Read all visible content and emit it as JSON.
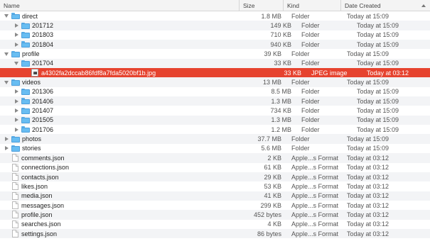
{
  "columns": {
    "name": "Name",
    "size": "Size",
    "kind": "Kind",
    "date": "Date Created"
  },
  "rows": [
    {
      "depth": 0,
      "expand": "down",
      "icon": "folder",
      "name": "direct",
      "size": "1.8 MB",
      "kind": "Folder",
      "date": "Today at 15:09"
    },
    {
      "depth": 1,
      "expand": "right",
      "icon": "folder",
      "name": "201712",
      "size": "149 KB",
      "kind": "Folder",
      "date": "Today at 15:09"
    },
    {
      "depth": 1,
      "expand": "right",
      "icon": "folder",
      "name": "201803",
      "size": "710 KB",
      "kind": "Folder",
      "date": "Today at 15:09"
    },
    {
      "depth": 1,
      "expand": "right",
      "icon": "folder",
      "name": "201804",
      "size": "940 KB",
      "kind": "Folder",
      "date": "Today at 15:09"
    },
    {
      "depth": 0,
      "expand": "down",
      "icon": "folder",
      "name": "profile",
      "size": "39 KB",
      "kind": "Folder",
      "date": "Today at 15:09"
    },
    {
      "depth": 1,
      "expand": "down",
      "icon": "folder",
      "name": "201704",
      "size": "33 KB",
      "kind": "Folder",
      "date": "Today at 15:09"
    },
    {
      "depth": 2,
      "expand": "none",
      "icon": "image",
      "name": "a4302fa2dccab86fdf8a7fda5020bf1b.jpg",
      "size": "33 KB",
      "kind": "JPEG image",
      "date": "Today at 03:12",
      "selected": true
    },
    {
      "depth": 0,
      "expand": "down",
      "icon": "folder",
      "name": "videos",
      "size": "13 MB",
      "kind": "Folder",
      "date": "Today at 15:09"
    },
    {
      "depth": 1,
      "expand": "right",
      "icon": "folder",
      "name": "201306",
      "size": "8.5 MB",
      "kind": "Folder",
      "date": "Today at 15:09"
    },
    {
      "depth": 1,
      "expand": "right",
      "icon": "folder",
      "name": "201406",
      "size": "1.3 MB",
      "kind": "Folder",
      "date": "Today at 15:09"
    },
    {
      "depth": 1,
      "expand": "right",
      "icon": "folder",
      "name": "201407",
      "size": "734 KB",
      "kind": "Folder",
      "date": "Today at 15:09"
    },
    {
      "depth": 1,
      "expand": "right",
      "icon": "folder",
      "name": "201505",
      "size": "1.3 MB",
      "kind": "Folder",
      "date": "Today at 15:09"
    },
    {
      "depth": 1,
      "expand": "right",
      "icon": "folder",
      "name": "201706",
      "size": "1.2 MB",
      "kind": "Folder",
      "date": "Today at 15:09"
    },
    {
      "depth": 0,
      "expand": "right",
      "icon": "folder",
      "name": "photos",
      "size": "37.7 MB",
      "kind": "Folder",
      "date": "Today at 15:09"
    },
    {
      "depth": 0,
      "expand": "right",
      "icon": "folder",
      "name": "stories",
      "size": "5.6 MB",
      "kind": "Folder",
      "date": "Today at 15:09"
    },
    {
      "depth": 0,
      "expand": "none",
      "icon": "document",
      "name": "comments.json",
      "size": "2 KB",
      "kind": "Apple...s Format",
      "date": "Today at 03:12"
    },
    {
      "depth": 0,
      "expand": "none",
      "icon": "document",
      "name": "connections.json",
      "size": "61 KB",
      "kind": "Apple...s Format",
      "date": "Today at 03:12"
    },
    {
      "depth": 0,
      "expand": "none",
      "icon": "document",
      "name": "contacts.json",
      "size": "29 KB",
      "kind": "Apple...s Format",
      "date": "Today at 03:12"
    },
    {
      "depth": 0,
      "expand": "none",
      "icon": "document",
      "name": "likes.json",
      "size": "53 KB",
      "kind": "Apple...s Format",
      "date": "Today at 03:12"
    },
    {
      "depth": 0,
      "expand": "none",
      "icon": "document",
      "name": "media.json",
      "size": "41 KB",
      "kind": "Apple...s Format",
      "date": "Today at 03:12"
    },
    {
      "depth": 0,
      "expand": "none",
      "icon": "document",
      "name": "messages.json",
      "size": "299 KB",
      "kind": "Apple...s Format",
      "date": "Today at 03:12"
    },
    {
      "depth": 0,
      "expand": "none",
      "icon": "document",
      "name": "profile.json",
      "size": "452 bytes",
      "kind": "Apple...s Format",
      "date": "Today at 03:12"
    },
    {
      "depth": 0,
      "expand": "none",
      "icon": "document",
      "name": "searches.json",
      "size": "4 KB",
      "kind": "Apple...s Format",
      "date": "Today at 03:12"
    },
    {
      "depth": 0,
      "expand": "none",
      "icon": "document",
      "name": "settings.json",
      "size": "86 bytes",
      "kind": "Apple...s Format",
      "date": "Today at 03:12"
    }
  ],
  "colors": {
    "selection": "#e6432f",
    "folder": "#68bdf2",
    "stripe": "#f3f4f6"
  },
  "icons": {
    "folder": "folder-icon",
    "image": "jpeg-image-icon",
    "document": "json-document-icon",
    "expand": "disclosure-triangle-icon"
  }
}
